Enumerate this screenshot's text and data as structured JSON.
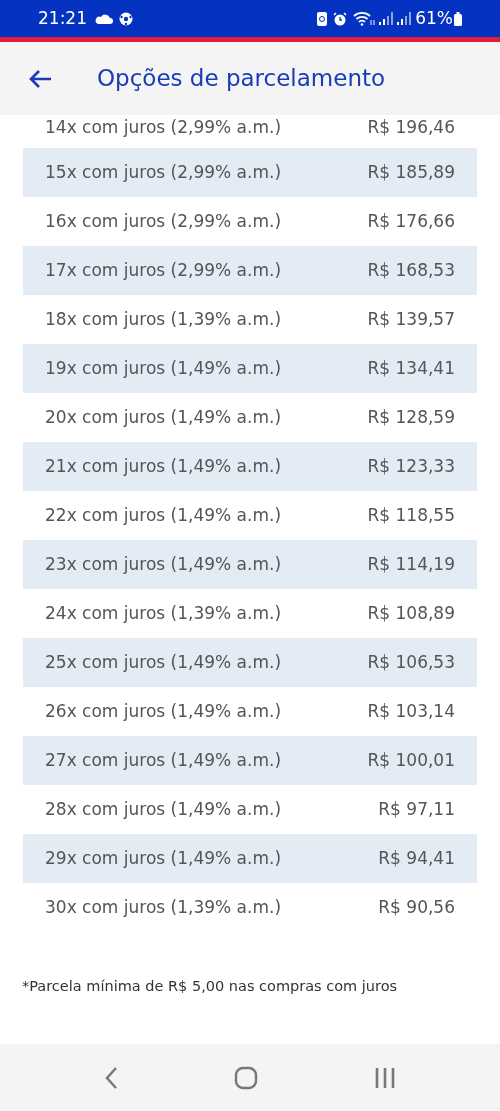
{
  "status_bar": {
    "time": "21:21",
    "battery": "61%"
  },
  "header": {
    "title": "Opções de parcelamento"
  },
  "options": [
    {
      "label": "14x com juros (2,99% a.m.)",
      "value": "R$ 196,46"
    },
    {
      "label": "15x com juros (2,99% a.m.)",
      "value": "R$ 185,89"
    },
    {
      "label": "16x com juros (2,99% a.m.)",
      "value": "R$ 176,66"
    },
    {
      "label": "17x com juros (2,99% a.m.)",
      "value": "R$ 168,53"
    },
    {
      "label": "18x com juros (1,39% a.m.)",
      "value": "R$ 139,57"
    },
    {
      "label": "19x com juros (1,49% a.m.)",
      "value": "R$ 134,41"
    },
    {
      "label": "20x com juros (1,49% a.m.)",
      "value": "R$ 128,59"
    },
    {
      "label": "21x com juros (1,49% a.m.)",
      "value": "R$ 123,33"
    },
    {
      "label": "22x com juros (1,49% a.m.)",
      "value": "R$ 118,55"
    },
    {
      "label": "23x com juros (1,49% a.m.)",
      "value": "R$ 114,19"
    },
    {
      "label": "24x com juros (1,39% a.m.)",
      "value": "R$ 108,89"
    },
    {
      "label": "25x com juros (1,49% a.m.)",
      "value": "R$ 106,53"
    },
    {
      "label": "26x com juros (1,49% a.m.)",
      "value": "R$ 103,14"
    },
    {
      "label": "27x com juros (1,49% a.m.)",
      "value": "R$ 100,01"
    },
    {
      "label": "28x com juros (1,49% a.m.)",
      "value": "R$ 97,11"
    },
    {
      "label": "29x com juros (1,49% a.m.)",
      "value": "R$ 94,41"
    },
    {
      "label": "30x com juros (1,39% a.m.)",
      "value": "R$ 90,56"
    }
  ],
  "footnote": "*Parcela mínima de R$ 5,00 nas compras com juros"
}
